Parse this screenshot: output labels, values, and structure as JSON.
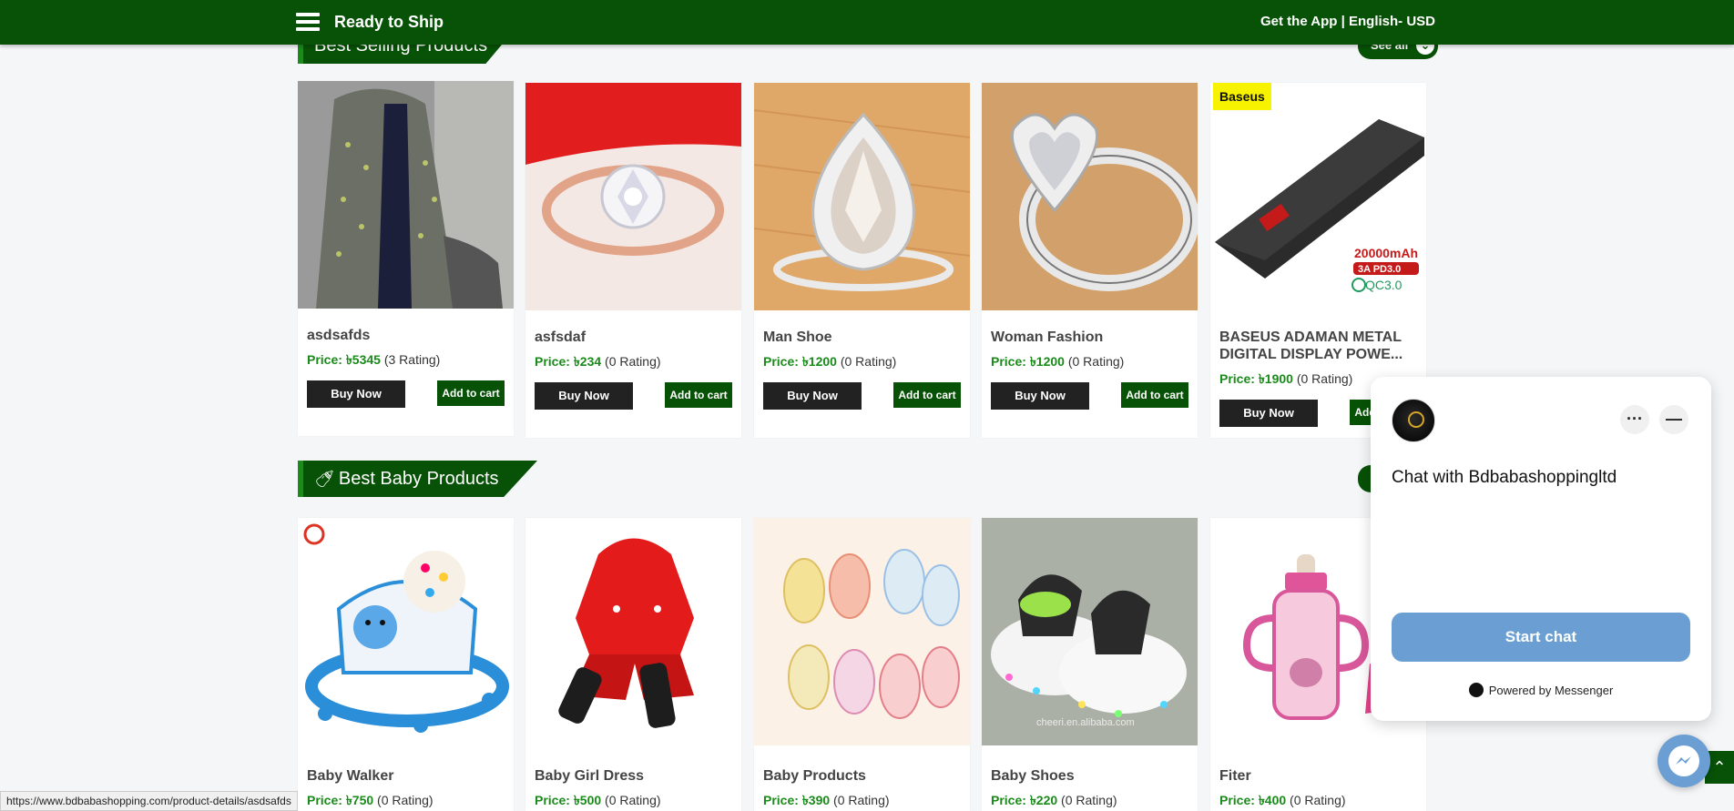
{
  "topbar": {
    "title": "Ready to Ship",
    "get_app": "Get the App",
    "separator": " | ",
    "language_currency": "English- USD"
  },
  "best_selling": {
    "title": "Best Selling Products",
    "see_all": "See all",
    "products": [
      {
        "name": "asdsafds",
        "price_label": "Price:",
        "price": "৳5345",
        "rating": "(3 Rating)",
        "buy": "Buy Now",
        "cart": "Add to cart"
      },
      {
        "name": "asfsdaf",
        "price_label": "Price:",
        "price": "৳234",
        "rating": "(0 Rating)",
        "buy": "Buy Now",
        "cart": "Add to cart"
      },
      {
        "name": "Man Shoe",
        "price_label": "Price:",
        "price": "৳1200",
        "rating": "(0 Rating)",
        "buy": "Buy Now",
        "cart": "Add to cart"
      },
      {
        "name": "Woman Fashion",
        "price_label": "Price:",
        "price": "৳1200",
        "rating": "(0 Rating)",
        "buy": "Buy Now",
        "cart": "Add to cart"
      },
      {
        "name": "BASEUS ADAMAN METAL DIGITAL DISPLAY POWE...",
        "price_label": "Price:",
        "price": "৳1900",
        "rating": "(0 Rating)",
        "buy": "Buy Now",
        "cart": "Add to cart",
        "badge": "Baseus",
        "img_text": [
          "20000mAh",
          "3A PD3.0",
          "QC3.0"
        ]
      }
    ]
  },
  "best_baby": {
    "title": "Best Baby Products",
    "products": [
      {
        "name": "Baby Walker",
        "price_label": "Price:",
        "price": "৳750",
        "rating": "(0 Rating)"
      },
      {
        "name": "Baby Girl Dress",
        "price_label": "Price:",
        "price": "৳500",
        "rating": "(0 Rating)"
      },
      {
        "name": "Baby Products",
        "price_label": "Price:",
        "price": "৳390",
        "rating": "(0 Rating)"
      },
      {
        "name": "Baby Shoes",
        "price_label": "Price:",
        "price": "৳220",
        "rating": "(0 Rating)",
        "img_text": "cheeri.en.alibaba.com"
      },
      {
        "name": "Fiter",
        "price_label": "Price:",
        "price": "৳400",
        "rating": "(0 Rating)"
      }
    ]
  },
  "chat": {
    "title": "Chat with Bdbabashoppingltd",
    "start": "Start chat",
    "powered": "Powered by Messenger",
    "more": "···",
    "minimize": "—"
  },
  "status_url": "https://www.bdbabashopping.com/product-details/asdsafds",
  "colors": {
    "brand_green": "#075207",
    "price_green": "#1a8a1a",
    "chat_blue": "#6b9fd3"
  },
  "icons": [
    "hamburger-menu-icon",
    "chevron-down-icon",
    "baby-icon",
    "messenger-icon",
    "chevron-up-icon"
  ]
}
